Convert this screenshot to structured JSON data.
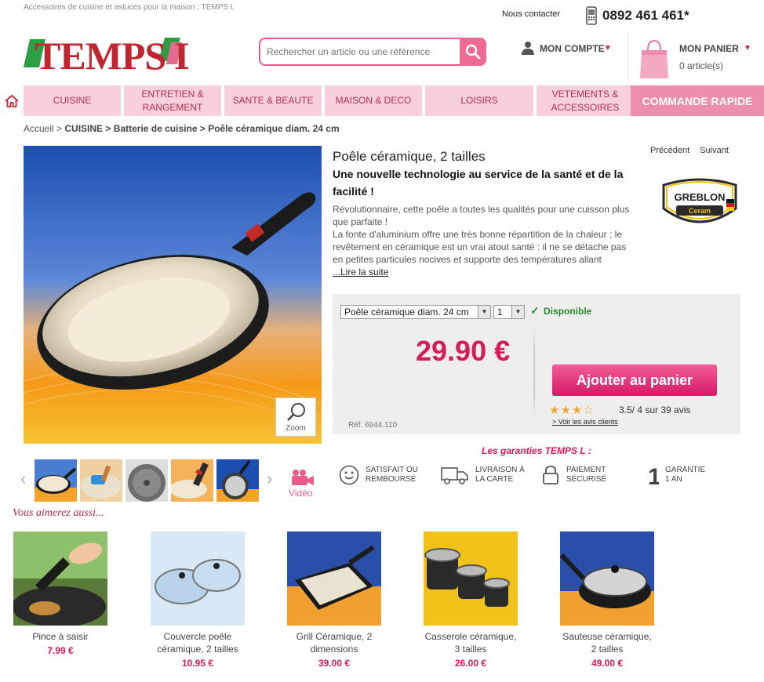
{
  "header": {
    "tagline": "Accessoires de cuisine et astuces pour la maison : TEMPS L",
    "contact_label": "Nous contacter",
    "phone": "0892 461 461*",
    "logo_text": "TEMPS L",
    "search_placeholder": "Rechercher un article ou une référence",
    "account_label": "MON COMPTE",
    "cart_label": "MON PANIER",
    "cart_count": "0 article(s)"
  },
  "nav": {
    "items": [
      {
        "label": "CUISINE"
      },
      {
        "label": "ENTRETIEN &\nRANGEMENT"
      },
      {
        "label": "SANTE & BEAUTE"
      },
      {
        "label": "MAISON & DECO"
      },
      {
        "label": "LOISIRS"
      },
      {
        "label": "VETEMENTS &\nACCESSOIRES"
      }
    ],
    "quick_order": "COMMANDE RAPIDE"
  },
  "breadcrumb": {
    "home": "Accueil",
    "sep": ">",
    "category": "CUISINE",
    "subcategory": "Batterie de cuisine",
    "current": "Poêle céramique diam. 24 cm"
  },
  "product": {
    "title": "Poêle céramique, 2 tailles",
    "subtitle": "Une nouvelle technologie au service de la santé et de la facilité !",
    "description": "Révolutionnaire, cette poêle a toutes les qualités pour une cuisson plus que parfaite !\nLa fonte d'aluminium offre une très bonne répartition de la chaleur ; le revêtement en céramique est un vrai atout santé : il ne se détache pas en petites particules nocives et supporte des températures allant",
    "read_more": "...Lire la suite",
    "prev": "Précédent",
    "next": "Suivant",
    "brand_logo": "GREBLON",
    "brand_sub": "Ceram",
    "zoom_label": "Zoom",
    "video_label": "Vidéo",
    "variant": "Poêle céramique diam. 24 cm",
    "quantity": "1",
    "availability": "Disponible",
    "price": "29.90 €",
    "add_to_cart": "Ajouter au panier",
    "rating_value": 3.5,
    "rating_text": "3.5/ 4 sur 39 avis",
    "reviews_link": "> Voir les avis clients",
    "ref": "Réf. 6944.110"
  },
  "guarantees": {
    "title": "Les garanties TEMPS L :",
    "items": [
      {
        "label": "SATISFAIT OU\nREMBOURSÉ",
        "icon": "smile-icon"
      },
      {
        "label": "LIVRAISON À\nLA CARTE",
        "icon": "truck-icon"
      },
      {
        "label": "PAIEMENT\nSÉCURISÉ",
        "icon": "lock-icon"
      },
      {
        "label": "GARANTIE\n1 AN",
        "icon": "one-year-icon"
      }
    ]
  },
  "recommendations": {
    "title": "Vous aimerez aussi...",
    "items": [
      {
        "name": "Pince à saisir",
        "price": "7.99 €"
      },
      {
        "name": "Couvercle poêle\ncéramique, 2 tailles",
        "price": "10.95 €"
      },
      {
        "name": "Grill Céramique, 2\ndimensions",
        "price": "39.00 €"
      },
      {
        "name": "Casserole céramique,\n3 tailles",
        "price": "26.00 €"
      },
      {
        "name": "Sauteuse céramique,\n2 tailles",
        "price": "49.00 €"
      }
    ]
  },
  "colors": {
    "accent": "#d61a5a",
    "nav_bg": "#f7cfdd",
    "nav_text": "#b5304e"
  }
}
